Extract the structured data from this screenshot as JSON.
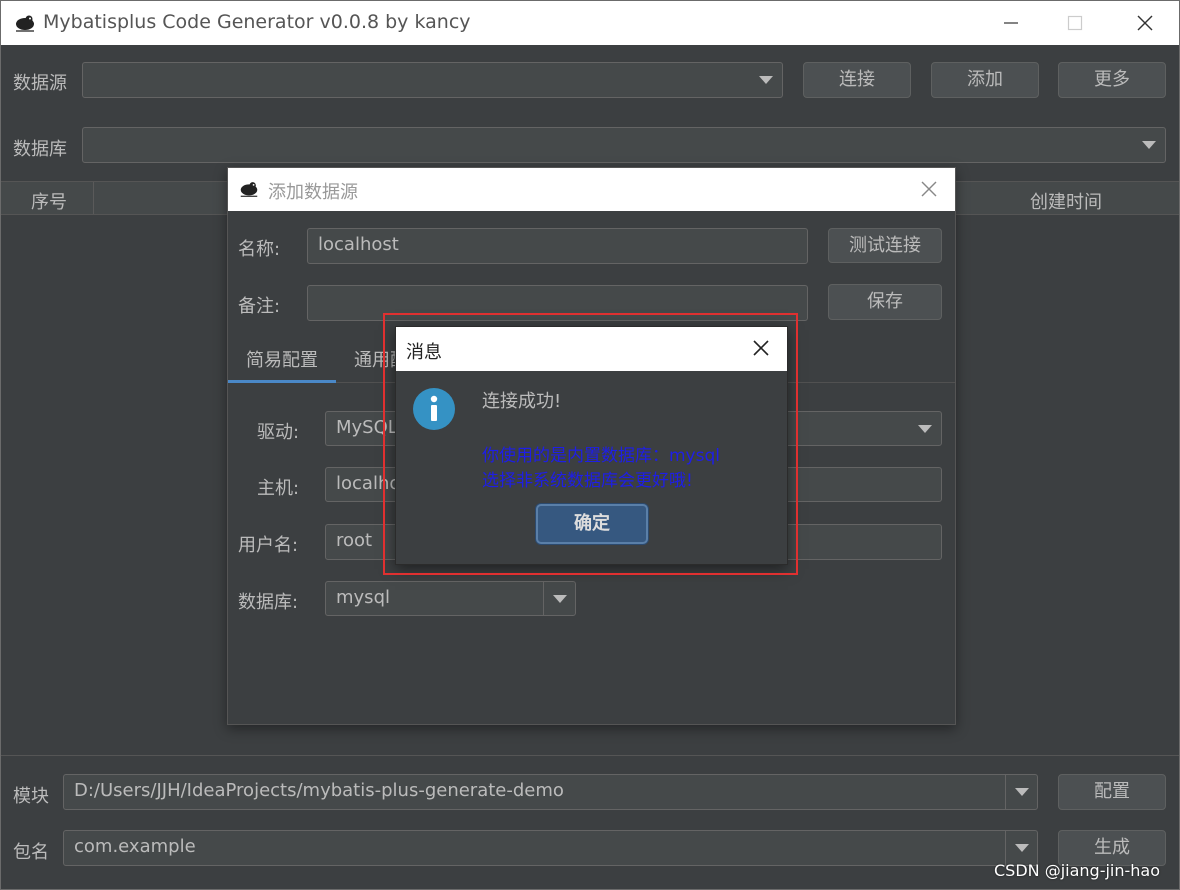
{
  "window": {
    "title": "Mybatisplus Code Generator v0.0.8 by kancy"
  },
  "toolbar": {
    "datasource_label": "数据源",
    "datasource_value": "",
    "connect_button": "连接",
    "add_button": "添加",
    "more_button": "更多",
    "database_label": "数据库",
    "database_value": ""
  },
  "table": {
    "columns": [
      "序号",
      "创建时间"
    ]
  },
  "bottom": {
    "module_label": "模块",
    "module_value": "D:/Users/JJH/IdeaProjects/mybatis-plus-generate-demo",
    "config_button": "配置",
    "package_label": "包名",
    "package_value": "com.example",
    "generate_button": "生成"
  },
  "add_dialog": {
    "title": "添加数据源",
    "name_label": "名称:",
    "name_value": "localhost",
    "test_button": "测试连接",
    "remark_label": "备注:",
    "remark_value": "",
    "save_button": "保存",
    "tabs": [
      "简易配置",
      "通用配"
    ],
    "driver_label": "驱动:",
    "driver_value": "MySQL",
    "host_label": "主机:",
    "host_value": "localho",
    "username_label": "用户名:",
    "username_value": "root",
    "database_label": "数据库:",
    "database_value": "mysql"
  },
  "message_dialog": {
    "title": "消息",
    "heading": "连接成功!",
    "line1": "你使用的是内置数据库：mysql",
    "line2": "选择非系统数据库会更好哦!",
    "ok_button": "确定"
  },
  "watermark": "CSDN @jiang-jin-hao",
  "colors": {
    "background": "#3c3f41",
    "field": "#45494a",
    "accent": "#4a88c7",
    "info_blue": "#3592c4",
    "message_text_blue": "#1e1ee6",
    "highlight_red": "#e03030"
  }
}
